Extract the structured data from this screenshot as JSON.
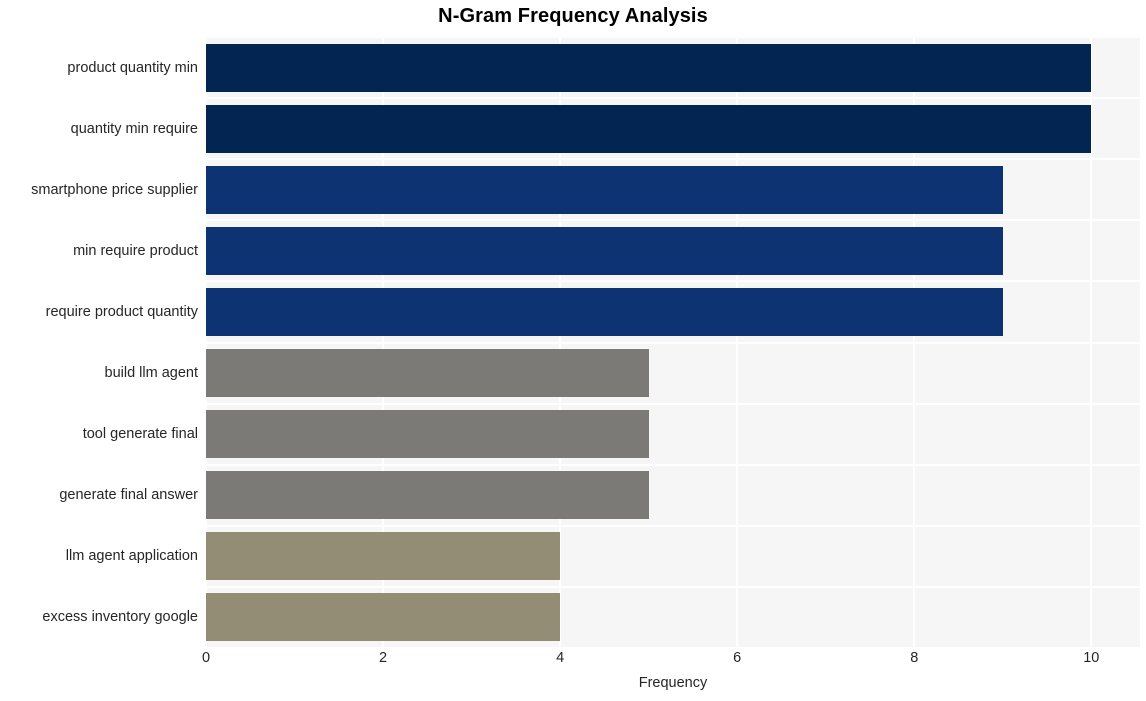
{
  "chart_data": {
    "type": "bar",
    "orientation": "horizontal",
    "title": "N-Gram Frequency Analysis",
    "xlabel": "Frequency",
    "ylabel": "",
    "categories": [
      "product quantity min",
      "quantity min require",
      "smartphone price supplier",
      "min require product",
      "require product quantity",
      "build llm agent",
      "tool generate final",
      "generate final answer",
      "llm agent application",
      "excess inventory google"
    ],
    "values": [
      10,
      10,
      9,
      9,
      9,
      5,
      5,
      5,
      4,
      4
    ],
    "bar_colors": [
      "#032552",
      "#032552",
      "#0d3372",
      "#0d3372",
      "#0d3372",
      "#7b7a77",
      "#7b7a77",
      "#7b7a77",
      "#948d76",
      "#948d76"
    ],
    "xlim": [
      0,
      10.55
    ],
    "xticks": [
      0,
      2,
      4,
      6,
      8,
      10
    ],
    "xtick_labels": [
      "0",
      "2",
      "4",
      "6",
      "8",
      "10"
    ],
    "grid": true,
    "grid_color": "#ffffff",
    "plot_background": "#f6f6f6",
    "figure_background": "#ffffff",
    "legend": null,
    "title_color": "#000000",
    "tick_label_color": "#262626"
  }
}
